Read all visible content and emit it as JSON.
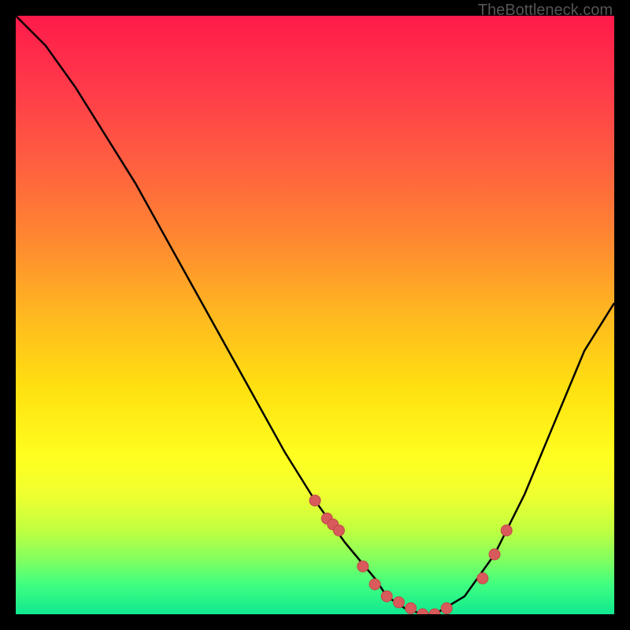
{
  "watermark": "TheBottleneck.com",
  "chart_data": {
    "type": "line",
    "title": "",
    "xlabel": "",
    "ylabel": "",
    "xlim": [
      0,
      100
    ],
    "ylim": [
      0,
      100
    ],
    "series": [
      {
        "name": "bottleneck-curve",
        "x": [
          0,
          5,
          10,
          15,
          20,
          25,
          30,
          35,
          40,
          45,
          50,
          55,
          60,
          62,
          65,
          68,
          70,
          75,
          80,
          85,
          90,
          95,
          100
        ],
        "y": [
          100,
          95,
          88,
          80,
          72,
          63,
          54,
          45,
          36,
          27,
          19,
          12,
          6,
          3,
          1,
          0,
          0,
          3,
          10,
          20,
          32,
          44,
          52
        ]
      }
    ],
    "scatter_points": {
      "name": "highlighted-points",
      "x": [
        50,
        52,
        53,
        54,
        58,
        60,
        62,
        64,
        66,
        68,
        70,
        72,
        78,
        80,
        82
      ],
      "y": [
        19,
        16,
        15,
        14,
        8,
        5,
        3,
        2,
        1,
        0,
        0,
        1,
        6,
        10,
        14
      ]
    },
    "color_gradient": {
      "top": "#ff1a4a",
      "middle": "#ffff20",
      "bottom": "#10e890"
    }
  }
}
